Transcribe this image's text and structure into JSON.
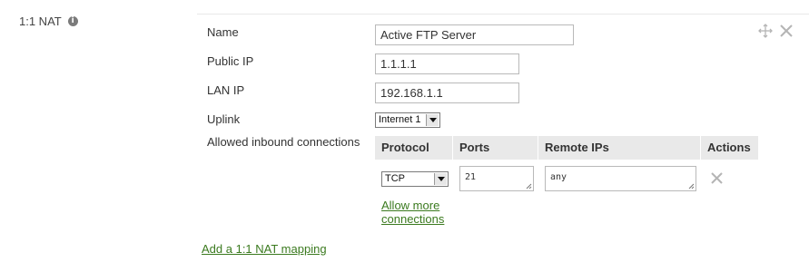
{
  "section": {
    "label": "1:1 NAT",
    "info_icon": "info-icon"
  },
  "mapping": {
    "name_label": "Name",
    "name_value": "Active FTP Server",
    "public_ip_label": "Public IP",
    "public_ip_value": "1.1.1.1",
    "lan_ip_label": "LAN IP",
    "lan_ip_value": "192.168.1.1",
    "uplink_label": "Uplink",
    "uplink_value": "Internet 1",
    "allowed_label": "Allowed inbound connections",
    "tools": [
      "move-icon",
      "close-icon"
    ]
  },
  "connections": {
    "headers": [
      "Protocol",
      "Ports",
      "Remote IPs",
      "Actions"
    ],
    "rows": [
      {
        "protocol": "TCP",
        "ports": "21",
        "remote_ips": "any",
        "action_icon": "remove-icon"
      }
    ],
    "allow_more_link": "Allow more connections"
  },
  "add_mapping_link": "Add a 1:1 NAT mapping",
  "colors": {
    "link": "#3b7a1f",
    "header_bg": "#e9e9e9",
    "icon_gray": "#b5b5b5"
  }
}
